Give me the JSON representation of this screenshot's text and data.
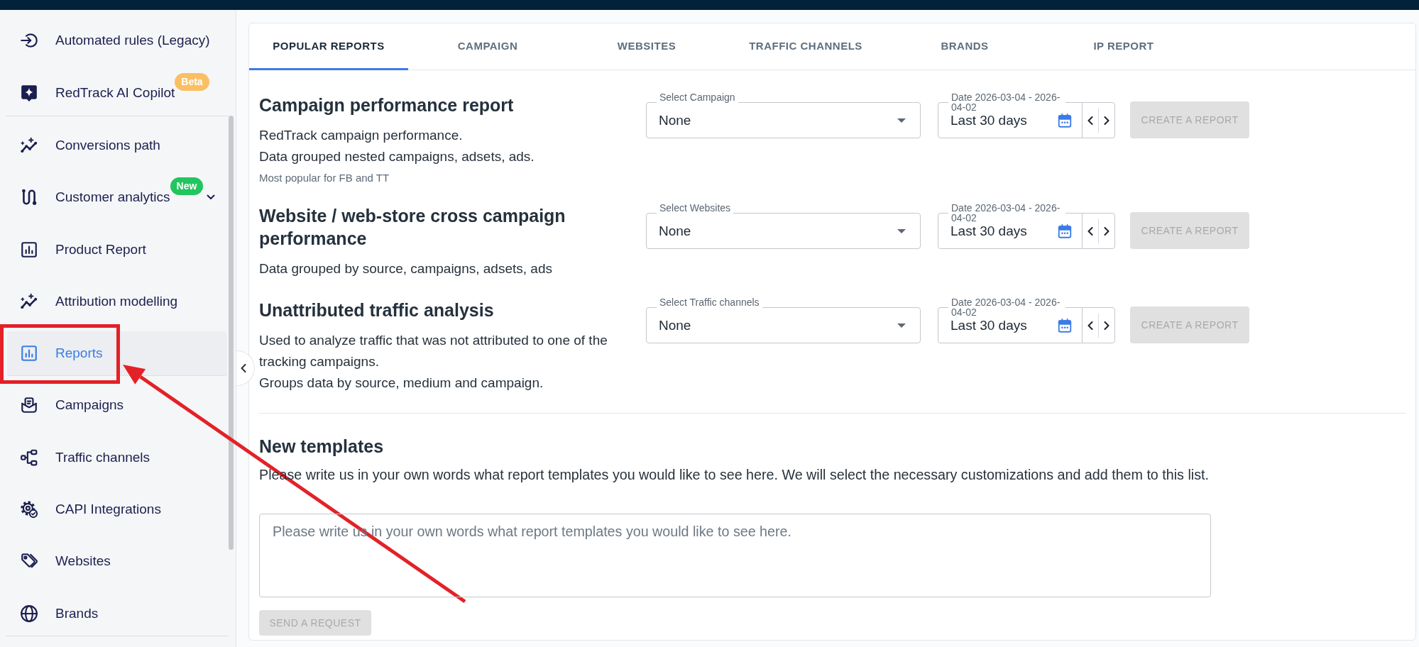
{
  "sidebar": {
    "sections": [
      {
        "items": [
          {
            "label": "Automated rules (Legacy)",
            "selected": false
          },
          {
            "label": "RedTrack AI Copilot",
            "selected": false,
            "badge": {
              "text": "Beta",
              "color": "#fbbf63"
            }
          }
        ]
      },
      {
        "items": [
          {
            "label": "Conversions path",
            "selected": false
          },
          {
            "label": "Customer analytics",
            "selected": false,
            "badge": {
              "text": "New",
              "color": "#22c55e"
            },
            "expanded": false
          },
          {
            "label": "Product Report",
            "selected": false
          },
          {
            "label": "Attribution modelling",
            "selected": false
          },
          {
            "label": "Reports",
            "selected": true
          },
          {
            "label": "Campaigns",
            "selected": false
          },
          {
            "label": "Traffic channels",
            "selected": false
          },
          {
            "label": "CAPI Integrations",
            "selected": false
          },
          {
            "label": "Websites",
            "selected": false
          },
          {
            "label": "Brands",
            "selected": false
          }
        ]
      }
    ]
  },
  "tabs": [
    {
      "label": "POPULAR REPORTS",
      "selected": true
    },
    {
      "label": "CAMPAIGN",
      "selected": false
    },
    {
      "label": "WEBSITES",
      "selected": false
    },
    {
      "label": "TRAFFIC CHANNELS",
      "selected": false
    },
    {
      "label": "BRANDS",
      "selected": false
    },
    {
      "label": "IP REPORT",
      "selected": false
    }
  ],
  "reports": [
    {
      "title": "Campaign performance report",
      "description": [
        "RedTrack campaign performance.",
        "Data grouped nested campaigns, adsets, ads."
      ],
      "note": "Most popular for FB and TT",
      "select": {
        "label": "Select Campaign",
        "value": "None"
      },
      "date": {
        "label": "Date 2026-03-04 - 2026-04-02",
        "value": "Last 30 days"
      },
      "button": {
        "label": "CREATE A REPORT",
        "disabled": true
      }
    },
    {
      "title": "Website / web-store cross campaign performance",
      "description": [
        "Data grouped by source, campaigns, adsets, ads"
      ],
      "select": {
        "label": "Select Websites",
        "value": "None"
      },
      "date": {
        "label": "Date 2026-03-04 - 2026-04-02",
        "value": "Last 30 days"
      },
      "button": {
        "label": "CREATE A REPORT",
        "disabled": true
      }
    },
    {
      "title": "Unattributed traffic analysis",
      "description": [
        "Used to analyze traffic that was not attributed to one of the tracking campaigns.",
        "Groups data by source, medium and campaign."
      ],
      "select": {
        "label": "Select Traffic channels",
        "value": "None"
      },
      "date": {
        "label": "Date 2026-03-04 - 2026-04-02",
        "value": "Last 30 days"
      },
      "button": {
        "label": "CREATE A REPORT",
        "disabled": true
      }
    }
  ],
  "templates": {
    "title": "New templates",
    "description": "Please write us in your own words what report templates you would like to see here. We will select the necessary customizations and add them to this list.",
    "input": {
      "placeholder": "Please write us in your own words what report templates you would like to see here."
    },
    "button": {
      "label": "SEND A REQUEST",
      "disabled": true
    }
  },
  "markup": {
    "highlight_frame": true,
    "arrow": true
  }
}
